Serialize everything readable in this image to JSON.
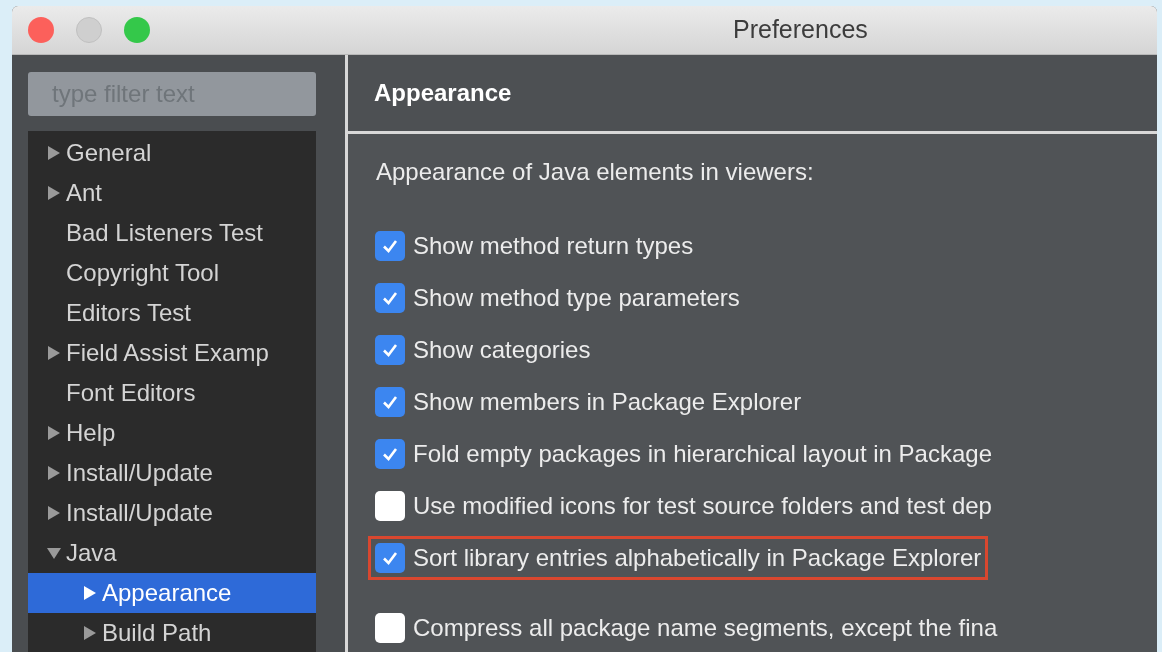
{
  "window": {
    "title": "Preferences",
    "controls": [
      {
        "kind": "close",
        "disabled": false
      },
      {
        "kind": "minimize",
        "disabled": true
      },
      {
        "kind": "zoom",
        "disabled": false
      }
    ]
  },
  "sidebar": {
    "filter": {
      "placeholder": "type filter text"
    },
    "tree": [
      {
        "label": "General",
        "expanded": false,
        "selected": false
      },
      {
        "label": "Ant",
        "expanded": false,
        "selected": false
      },
      {
        "label": "Bad Listeners Test",
        "selected": false
      },
      {
        "label": "Copyright Tool",
        "selected": false
      },
      {
        "label": "Editors Test",
        "selected": false
      },
      {
        "label": "Field Assist Examp",
        "expanded": false,
        "selected": false
      },
      {
        "label": "Font Editors",
        "selected": false
      },
      {
        "label": "Help",
        "expanded": false,
        "selected": false
      },
      {
        "label": "Install/Update",
        "expanded": false,
        "selected": false
      },
      {
        "label": "Install/Update",
        "expanded": false,
        "selected": false
      },
      {
        "label": "Java",
        "expanded": true,
        "selected": false,
        "children": [
          {
            "label": "Appearance",
            "expanded": false,
            "selected": true
          },
          {
            "label": "Build Path",
            "expanded": false,
            "selected": false
          }
        ]
      }
    ]
  },
  "page": {
    "title": "Appearance",
    "description": "Appearance of Java elements in viewers:",
    "options": [
      {
        "label": "Show method return types",
        "checked": true,
        "highlighted": false
      },
      {
        "label": "Show method type parameters",
        "checked": true,
        "highlighted": false
      },
      {
        "label": "Show categories",
        "checked": true,
        "highlighted": false
      },
      {
        "label": "Show members in Package Explorer",
        "checked": true,
        "highlighted": false
      },
      {
        "label": "Fold empty packages in hierarchical layout in Package",
        "checked": true,
        "highlighted": false
      },
      {
        "label": "Use modified icons for test source folders and test dep",
        "checked": false,
        "highlighted": false
      },
      {
        "label": "Sort library entries alphabetically in Package Explorer",
        "checked": true,
        "highlighted": true
      },
      {
        "label": "Compress all package name segments, except the fina",
        "checked": false,
        "highlighted": false
      }
    ]
  }
}
